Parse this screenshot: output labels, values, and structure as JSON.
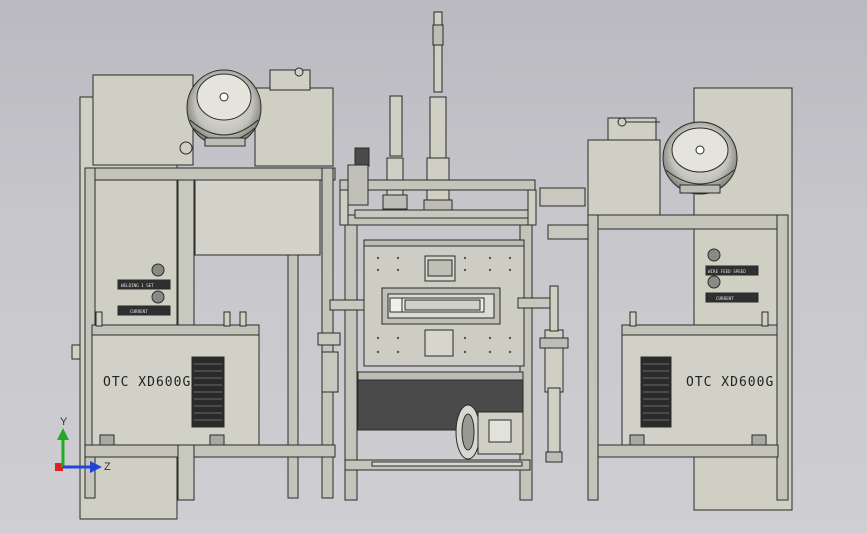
{
  "left_welder": {
    "brand_label": "OTC XD600G",
    "plate_top": "WELDING 1 SET",
    "plate_bottom": "CURRENT"
  },
  "right_welder": {
    "brand_label": "OTC XD600G",
    "plate_top": "WIRE FEED SPEED",
    "plate_bottom": "CURRENT"
  },
  "axis_triad": {
    "y_label": "Y",
    "z_label": "Z",
    "colors": {
      "y": "#22aa22",
      "z": "#2244dd",
      "x": "#dd2222"
    }
  },
  "colors": {
    "body": "#cfcfc4",
    "frame": "#c4c4ba",
    "outline": "#2b2b2b",
    "dark": "#4a4a4a"
  }
}
